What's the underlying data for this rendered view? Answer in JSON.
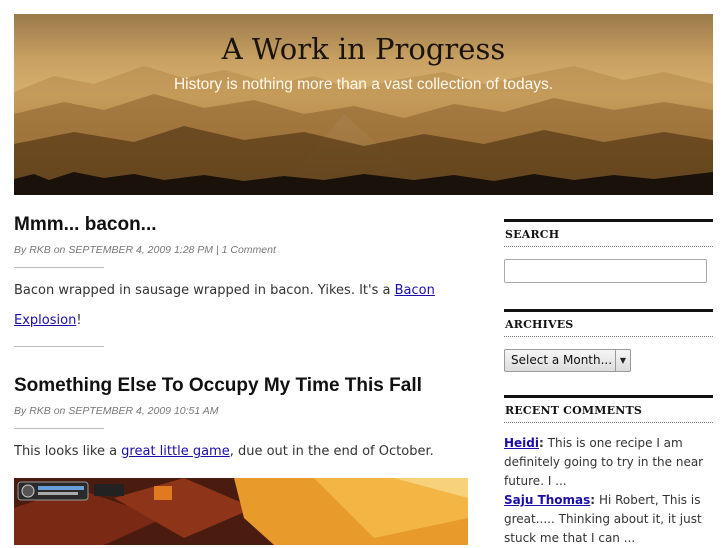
{
  "header": {
    "title": "A Work in Progress",
    "tagline": "History is nothing more than a vast collection of todays."
  },
  "posts": [
    {
      "title": "Mmm... bacon...",
      "meta_by": "By",
      "author": "RKB",
      "meta_on": "on",
      "date": "SEPTEMBER 4, 2009 1:28 PM",
      "sep": "|",
      "comments": "1 Comment",
      "body_before": "Bacon wrapped in sausage wrapped in bacon. Yikes. It's a ",
      "link": "Bacon Explosion",
      "body_after": "!"
    },
    {
      "title": "Something Else To Occupy My Time This Fall",
      "meta_by": "By",
      "author": "RKB",
      "meta_on": "on",
      "date": "SEPTEMBER 4, 2009 10:51 AM",
      "body_before": "This looks like a ",
      "link": "great little game",
      "body_after": ", due out in the end of October."
    }
  ],
  "sidebar": {
    "search_heading": "SEARCH",
    "search_value": "",
    "archives_heading": "ARCHIVES",
    "archives_select": "Select a Month...",
    "recent_heading": "RECENT COMMENTS",
    "comments": [
      {
        "author": "Heidi",
        "text": "This is one recipe I am definitely going to try in the near future. I ..."
      },
      {
        "author": "Saju Thomas",
        "text": "Hi Robert, This is great..... Thinking about it, it just stuck me that I can ..."
      }
    ]
  },
  "colors": {
    "link": "#1a0dab",
    "header_sky": "#d8b06c"
  }
}
